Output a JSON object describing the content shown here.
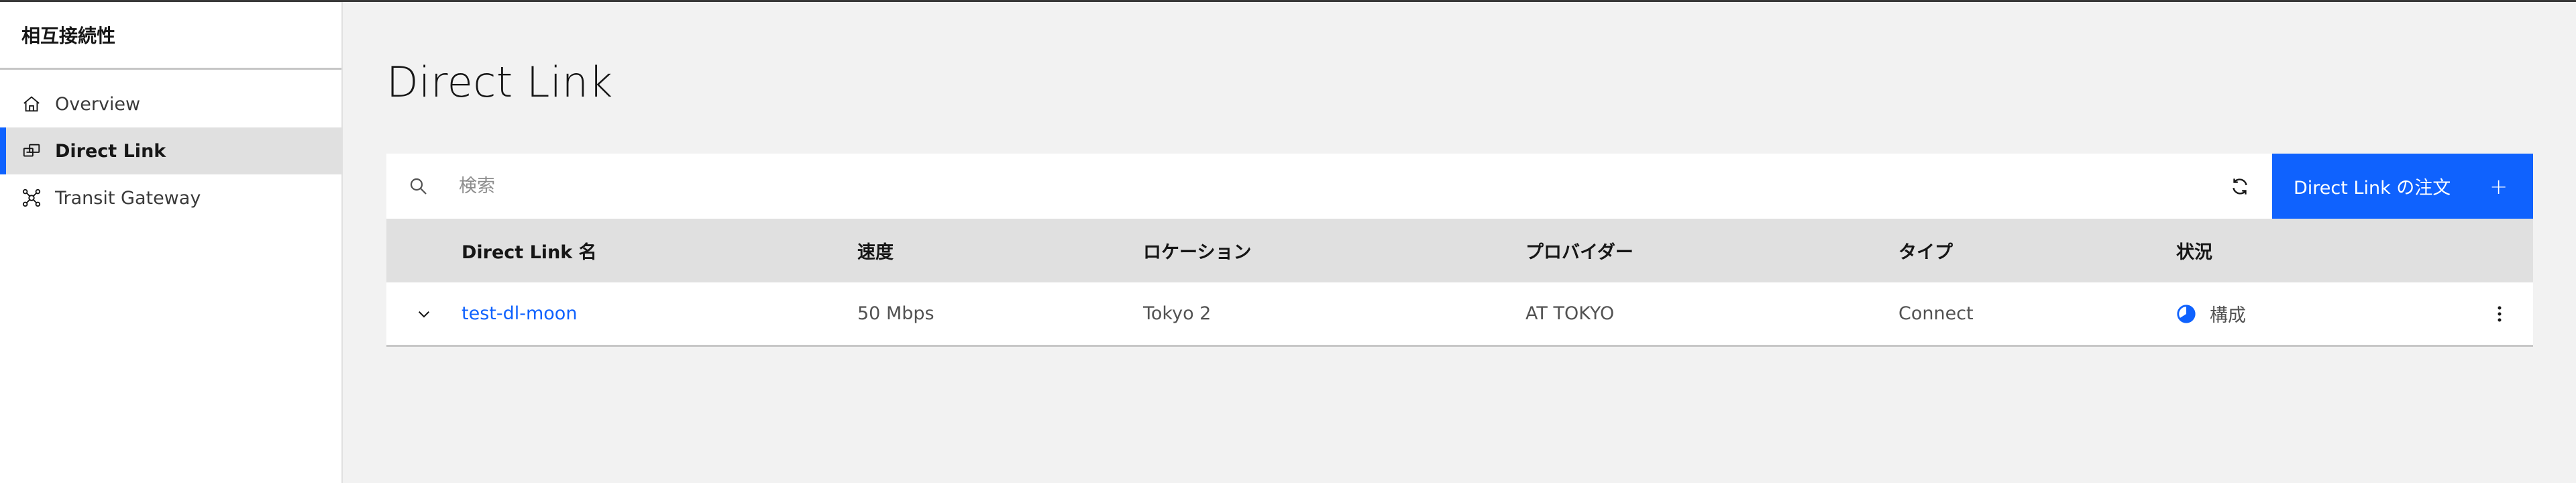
{
  "sidebar": {
    "title": "相互接続性",
    "items": [
      {
        "label": "Overview",
        "icon": "home-icon"
      },
      {
        "label": "Direct Link",
        "icon": "direct-link-icon",
        "active": true
      },
      {
        "label": "Transit Gateway",
        "icon": "transit-gateway-icon"
      }
    ]
  },
  "page": {
    "title": "Direct Link"
  },
  "toolbar": {
    "search_placeholder": "検索",
    "order_button_label": "Direct Link の注文",
    "order_button_icon": "+"
  },
  "table": {
    "columns": [
      "Direct Link 名",
      "速度",
      "ロケーション",
      "プロバイダー",
      "タイプ",
      "状況"
    ],
    "rows": [
      {
        "name": "test-dl-moon",
        "speed": "50 Mbps",
        "location": "Tokyo 2",
        "provider": "AT TOKYO",
        "type": "Connect",
        "status": "構成"
      }
    ]
  },
  "colors": {
    "accent": "#0f62fe",
    "sidebar_bg": "#ffffff",
    "page_bg": "#f2f2f2",
    "header_bg": "#e0e0e0"
  }
}
